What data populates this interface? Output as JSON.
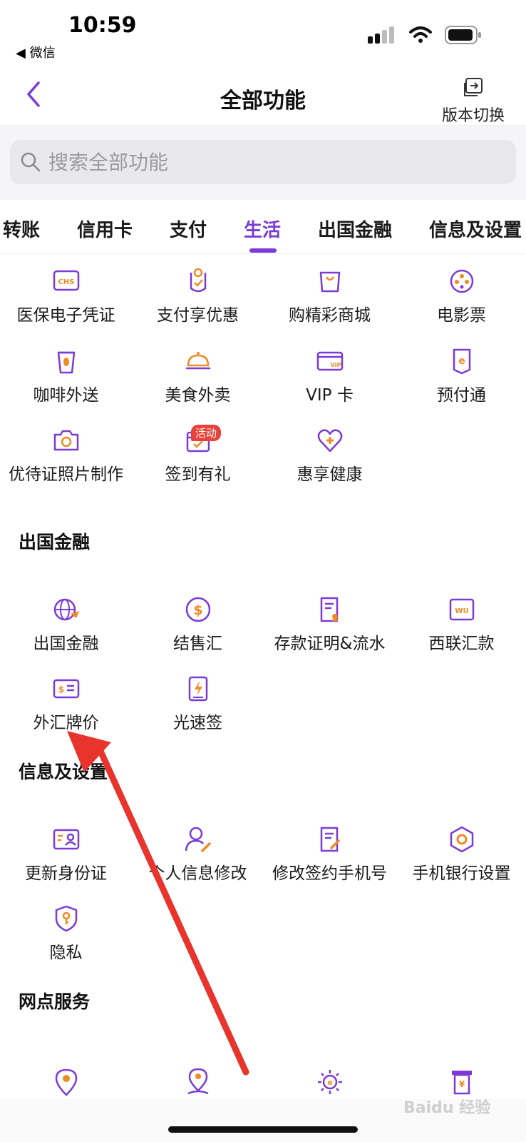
{
  "status_bar": {
    "time": "10:59",
    "back_app": "◀ 微信"
  },
  "nav": {
    "title": "全部功能",
    "version_switch": "版本切换"
  },
  "search": {
    "placeholder": "搜索全部功能"
  },
  "tabs": [
    {
      "label": "转账"
    },
    {
      "label": "信用卡"
    },
    {
      "label": "支付"
    },
    {
      "label": "生活",
      "active": true
    },
    {
      "label": "出国金融"
    },
    {
      "label": "信息及设置"
    }
  ],
  "life": {
    "items": [
      {
        "label": "医保电子凭证",
        "icon": "chs-card-icon"
      },
      {
        "label": "支付享优惠",
        "icon": "badge-icon"
      },
      {
        "label": "购精彩商城",
        "icon": "shopping-bag-icon"
      },
      {
        "label": "电影票",
        "icon": "film-reel-icon"
      },
      {
        "label": "咖啡外送",
        "icon": "coffee-cup-icon"
      },
      {
        "label": "美食外卖",
        "icon": "food-cloche-icon"
      },
      {
        "label": "VIP 卡",
        "icon": "vip-card-icon"
      },
      {
        "label": "预付通",
        "icon": "prepaid-e-icon"
      },
      {
        "label": "优待证照片制作",
        "icon": "camera-icon"
      },
      {
        "label": "签到有礼",
        "icon": "calendar-check-icon",
        "badge": "活动"
      },
      {
        "label": "惠享健康",
        "icon": "heart-plus-icon"
      }
    ]
  },
  "overseas": {
    "title": "出国金融",
    "items": [
      {
        "label": "出国金融",
        "icon": "globe-plane-icon"
      },
      {
        "label": "结售汇",
        "icon": "dollar-coin-icon"
      },
      {
        "label": "存款证明&流水",
        "icon": "certificate-icon"
      },
      {
        "label": "西联汇款",
        "icon": "western-union-icon"
      },
      {
        "label": "外汇牌价",
        "icon": "fx-rate-icon"
      },
      {
        "label": "光速签",
        "icon": "lightning-doc-icon"
      }
    ]
  },
  "settings": {
    "title": "信息及设置",
    "items": [
      {
        "label": "更新身份证",
        "icon": "id-card-icon"
      },
      {
        "label": "个人信息修改",
        "icon": "user-edit-icon"
      },
      {
        "label": "修改签约手机号",
        "icon": "doc-edit-icon"
      },
      {
        "label": "手机银行设置",
        "icon": "hex-settings-icon"
      },
      {
        "label": "隐私",
        "icon": "shield-key-icon"
      }
    ]
  },
  "branch": {
    "title": "网点服务",
    "items": [
      {
        "icon": "location-pin-icon"
      },
      {
        "icon": "location-person-icon"
      },
      {
        "icon": "sun-e-icon"
      },
      {
        "icon": "atm-icon"
      }
    ]
  },
  "watermark": "Baidu 经验",
  "colors": {
    "accent": "#7a3bd6",
    "icon_orange": "#f08a24",
    "badge_red": "#e8433a",
    "arrow_red": "#e8342c"
  }
}
